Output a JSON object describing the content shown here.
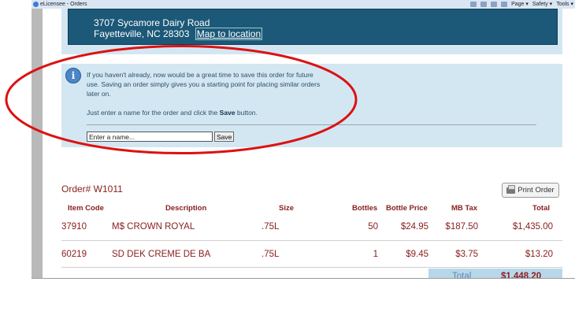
{
  "browser": {
    "tab_title": "eLicensee - Orders",
    "tools": [
      "Page ▾",
      "Safety ▾",
      "Tools ▾"
    ]
  },
  "address": {
    "line1": "3707 Sycamore Dairy Road",
    "line2": "Fayetteville, NC 28303",
    "map_link": "Map to location"
  },
  "save_panel": {
    "message": "If you haven't already, now would be a great time to save this order for future use. Saving an order simply gives you a starting point for placing similar orders later on.",
    "instruction_before": "Just enter a name for the order and click the ",
    "instruction_bold": "Save",
    "instruction_after": " button.",
    "input_placeholder": "Enter a name...",
    "save_label": "Save"
  },
  "order": {
    "number": "Order# W1011",
    "print_label": "Print Order",
    "columns": [
      "Item Code",
      "Description",
      "Size",
      "Bottles",
      "Bottle Price",
      "MB Tax",
      "Total"
    ],
    "rows": [
      {
        "code": "37910",
        "description": "M$ CROWN ROYAL",
        "size": ".75L",
        "bottles": "50",
        "price": "$24.95",
        "tax": "$187.50",
        "total": "$1,435.00"
      },
      {
        "code": "60219",
        "description": "SD DEK CREME DE BA",
        "size": ".75L",
        "bottles": "1",
        "price": "$9.45",
        "tax": "$3.75",
        "total": "$13.20"
      }
    ],
    "total_label": "Total",
    "total_value": "$1,448.20"
  },
  "colors": {
    "accent_red": "#8a2020",
    "banner_blue": "#1c5878",
    "panel_bg": "#d3e7f2",
    "annotation_red": "#dd1111"
  }
}
